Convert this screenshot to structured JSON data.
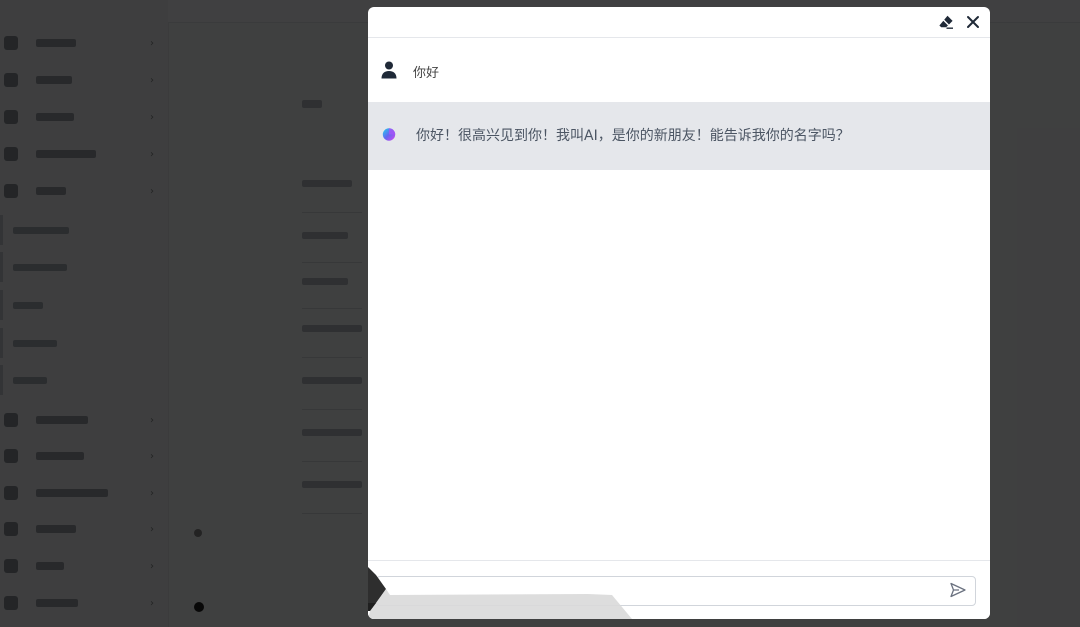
{
  "background_app": {
    "nav_items": [
      "",
      "",
      "",
      "",
      "",
      "",
      "",
      "",
      "",
      "",
      "",
      "",
      "",
      "",
      "",
      ""
    ]
  },
  "chat": {
    "header": {
      "clear_icon": "eraser-icon",
      "close_icon": "close-icon"
    },
    "messages": [
      {
        "role": "user",
        "avatar_icon": "user-icon",
        "text": "你好"
      },
      {
        "role": "assistant",
        "avatar_icon": "ai-logo-icon",
        "text": "你好！很高兴见到你！我叫AI，是你的新朋友！能告诉我你的名字吗？"
      }
    ],
    "input": {
      "value": "",
      "placeholder": ""
    },
    "send_icon": "send-icon"
  },
  "colors": {
    "overlay": "#000000",
    "assistant_bg": "#e5e7eb",
    "modal_bg": "#ffffff",
    "icon_dark": "#1f2937"
  }
}
